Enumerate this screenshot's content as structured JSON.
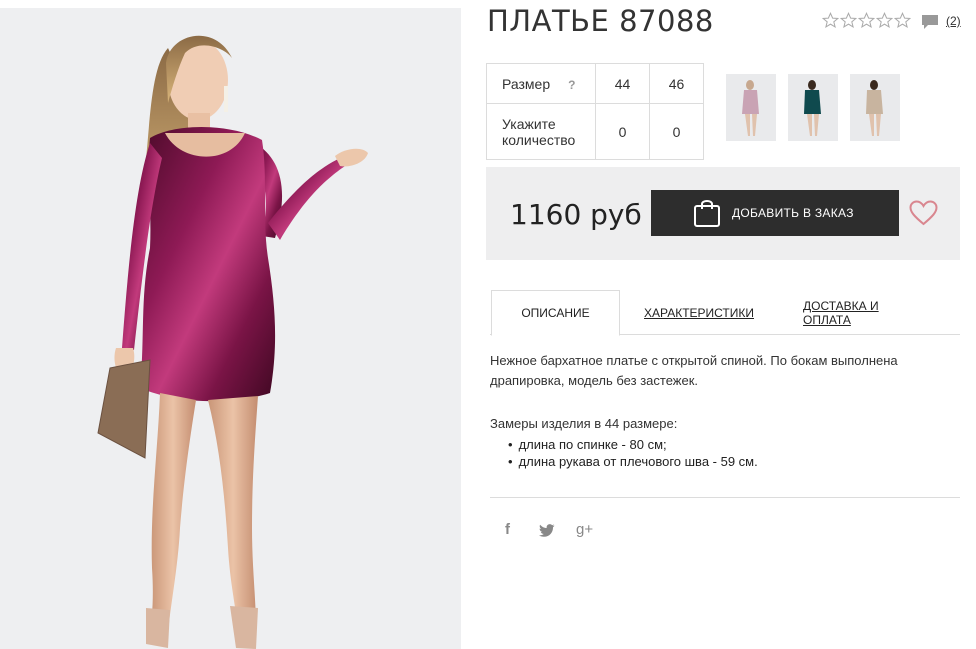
{
  "product": {
    "title": "ПЛАТЬЕ 87088",
    "rating_stars": 5,
    "rating_value": 0,
    "reviews_count": "(2)",
    "price": "1160 руб"
  },
  "size_table": {
    "size_label": "Размер",
    "help_mark": "?",
    "sizes": [
      "44",
      "46"
    ],
    "quantity_label_line1": "Укажите",
    "quantity_label_line2": "количество",
    "quantities": [
      "0",
      "0"
    ]
  },
  "thumbnails": [
    {
      "color": "#c9a3b4"
    },
    {
      "color": "#0f4a4e"
    },
    {
      "color": "#c8b49f"
    }
  ],
  "buy": {
    "add_label": "ДОБАВИТЬ В ЗАКАЗ"
  },
  "tabs": [
    {
      "label": "ОПИСАНИЕ",
      "active": true
    },
    {
      "label": "ХАРАКТЕРИСТИКИ",
      "active": false
    },
    {
      "label": "ДОСТАВКА И ОПЛАТА",
      "active": false
    }
  ],
  "description": {
    "text": "Нежное бархатное платье с открытой спиной. По бокам выполнена драпировка, модель без застежек.",
    "measure_title": "Замеры изделия в 44 размере:",
    "measures": [
      "длина по спинке - 80 см;",
      "длина рукава от плечового шва - 59 см."
    ]
  },
  "social": [
    {
      "icon": "facebook-icon",
      "glyph": "f"
    },
    {
      "icon": "twitter-icon",
      "glyph": "🐦"
    },
    {
      "icon": "google-plus-icon",
      "glyph": "g+"
    }
  ],
  "colors": {
    "dress": "#7a1446",
    "button": "#2d2d2d",
    "heart": "#d9868f",
    "panel": "#eeeeef"
  }
}
